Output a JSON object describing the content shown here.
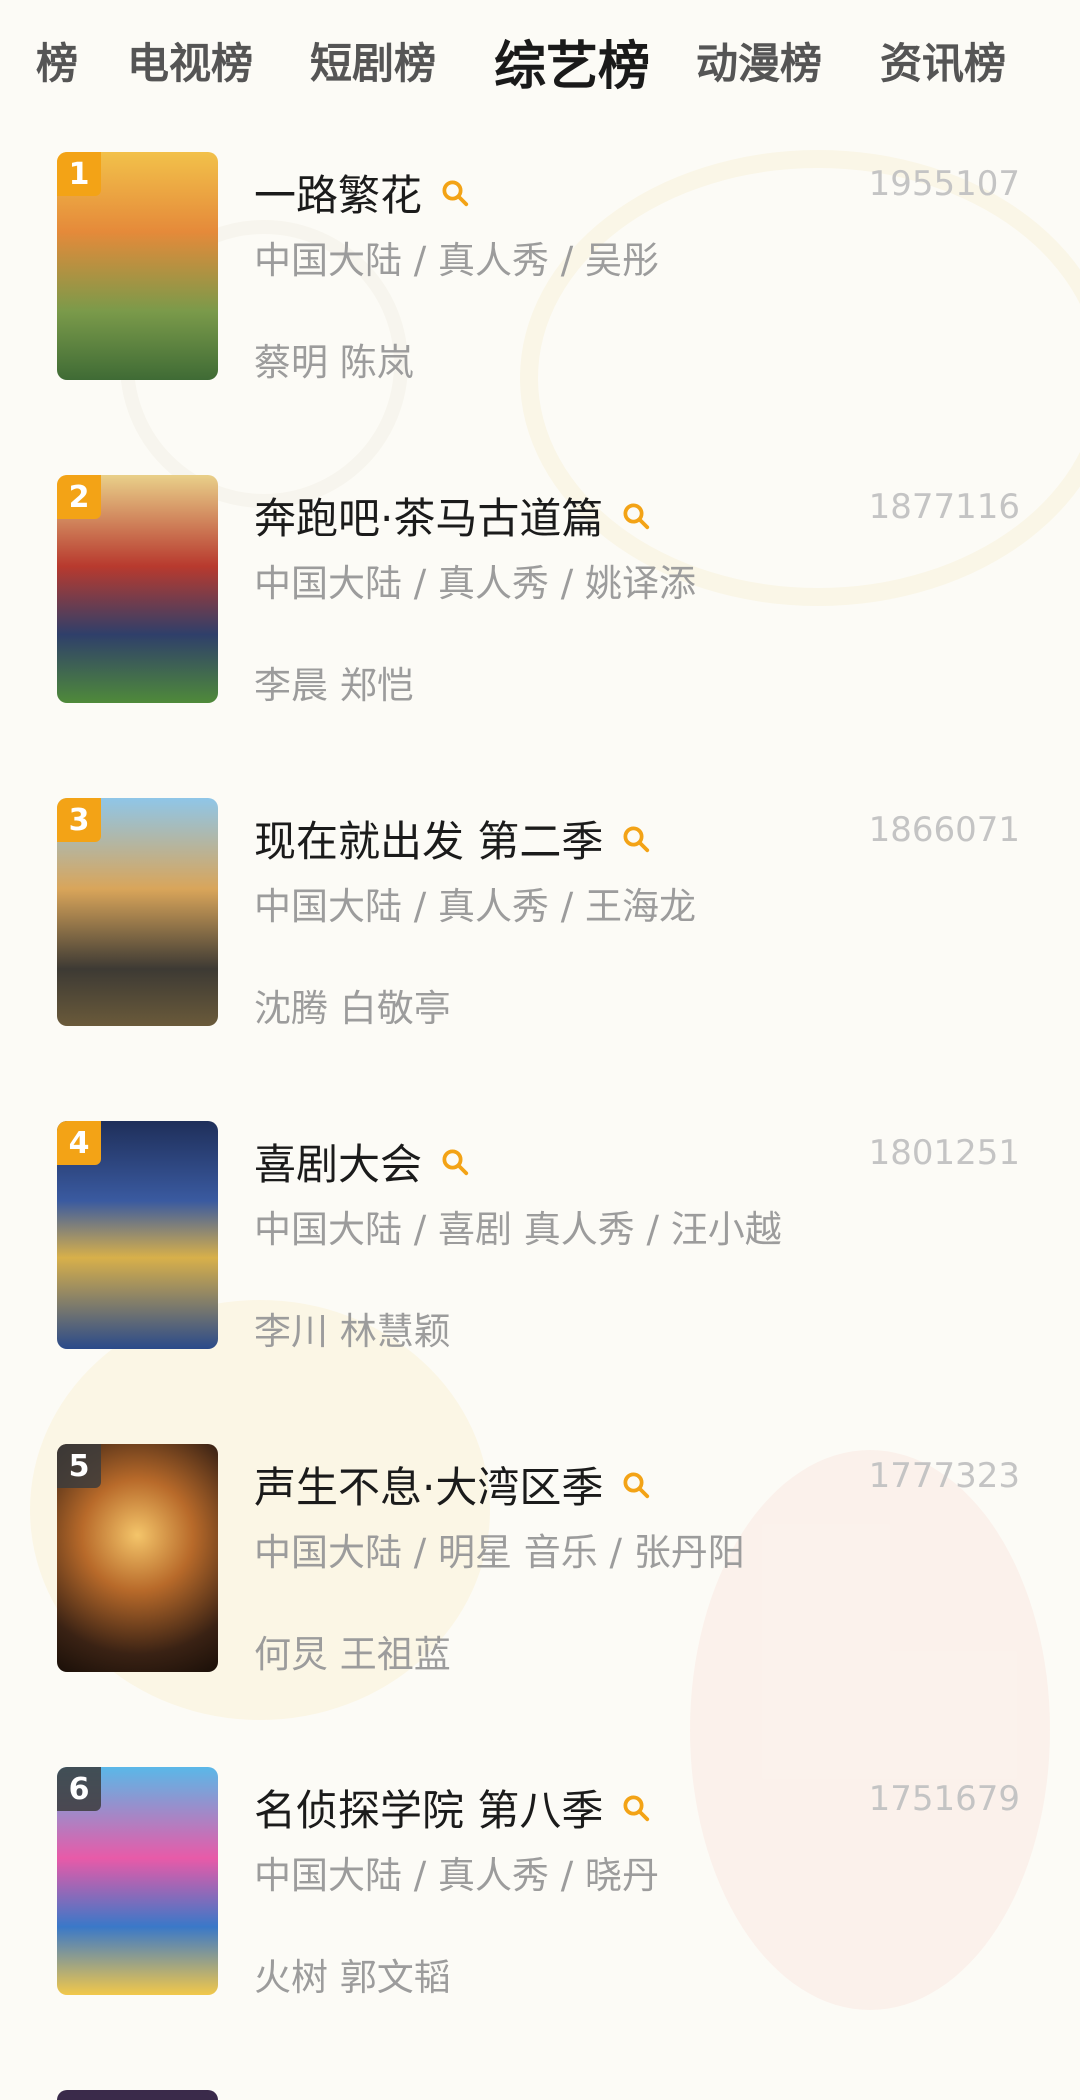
{
  "tabs": [
    {
      "label": "榜"
    },
    {
      "label": "电视榜"
    },
    {
      "label": "短剧榜"
    },
    {
      "label": "综艺榜"
    },
    {
      "label": "动漫榜"
    },
    {
      "label": "资讯榜"
    }
  ],
  "active_tab": "综艺榜",
  "accent_color": "#f3a316",
  "icons": {
    "search": "search-icon"
  },
  "items": [
    {
      "rank": "1",
      "title": "一路繁花",
      "meta": "中国大陆 / 真人秀 / 吴彤",
      "people": "蔡明 陈岚",
      "score": "1955107"
    },
    {
      "rank": "2",
      "title": "奔跑吧·茶马古道篇",
      "meta": "中国大陆 / 真人秀 / 姚译添",
      "people": "李晨 郑恺",
      "score": "1877116"
    },
    {
      "rank": "3",
      "title": "现在就出发 第二季",
      "meta": "中国大陆 / 真人秀 / 王海龙",
      "people": "沈腾 白敬亭",
      "score": "1866071"
    },
    {
      "rank": "4",
      "title": "喜剧大会",
      "meta": "中国大陆 / 喜剧 真人秀 / 汪小越",
      "people": "李川 林慧颖",
      "score": "1801251"
    },
    {
      "rank": "5",
      "title": "声生不息·大湾区季",
      "meta": "中国大陆 / 明星 音乐 / 张丹阳",
      "people": "何炅 王祖蓝",
      "score": "1777323"
    },
    {
      "rank": "6",
      "title": "名侦探学院 第八季",
      "meta": "中国大陆 / 真人秀 / 晓丹",
      "people": "火树 郭文韬",
      "score": "1751679"
    }
  ]
}
